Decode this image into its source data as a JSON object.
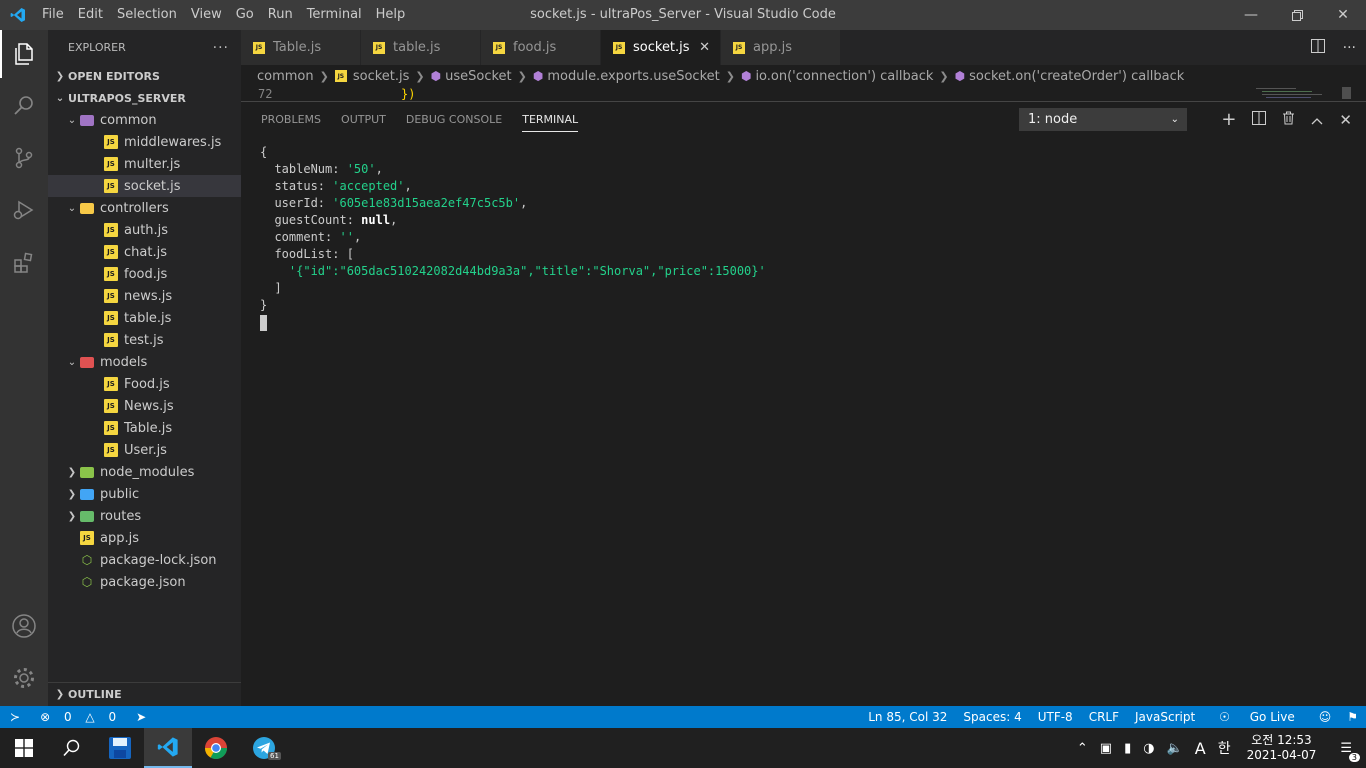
{
  "window": {
    "title": "socket.js - ultraPos_Server - Visual Studio Code",
    "menu": [
      "File",
      "Edit",
      "Selection",
      "View",
      "Go",
      "Run",
      "Terminal",
      "Help"
    ]
  },
  "sidebar": {
    "header": "EXPLORER",
    "open_editors": "OPEN EDITORS",
    "project": "ULTRAPOS_SERVER",
    "outline": "OUTLINE",
    "tree": [
      {
        "label": "common",
        "type": "folder",
        "depth": 1,
        "expanded": true
      },
      {
        "label": "middlewares.js",
        "type": "js",
        "depth": 2
      },
      {
        "label": "multer.js",
        "type": "js",
        "depth": 2
      },
      {
        "label": "socket.js",
        "type": "js",
        "depth": 2,
        "selected": true
      },
      {
        "label": "controllers",
        "type": "folder",
        "depth": 1,
        "expanded": true
      },
      {
        "label": "auth.js",
        "type": "js",
        "depth": 2
      },
      {
        "label": "chat.js",
        "type": "js",
        "depth": 2
      },
      {
        "label": "food.js",
        "type": "js",
        "depth": 2
      },
      {
        "label": "news.js",
        "type": "js",
        "depth": 2
      },
      {
        "label": "table.js",
        "type": "js",
        "depth": 2
      },
      {
        "label": "test.js",
        "type": "js",
        "depth": 2
      },
      {
        "label": "models",
        "type": "folder",
        "depth": 1,
        "expanded": true
      },
      {
        "label": "Food.js",
        "type": "js",
        "depth": 2
      },
      {
        "label": "News.js",
        "type": "js",
        "depth": 2
      },
      {
        "label": "Table.js",
        "type": "js",
        "depth": 2
      },
      {
        "label": "User.js",
        "type": "js",
        "depth": 2
      },
      {
        "label": "node_modules",
        "type": "folder",
        "depth": 1,
        "expanded": false
      },
      {
        "label": "public",
        "type": "folder",
        "depth": 1,
        "expanded": false
      },
      {
        "label": "routes",
        "type": "folder",
        "depth": 1,
        "expanded": false
      },
      {
        "label": "app.js",
        "type": "js",
        "depth": 1
      },
      {
        "label": "package-lock.json",
        "type": "json",
        "depth": 1
      },
      {
        "label": "package.json",
        "type": "json",
        "depth": 1
      }
    ]
  },
  "tabs": [
    {
      "label": "Table.js",
      "active": false
    },
    {
      "label": "table.js",
      "active": false
    },
    {
      "label": "food.js",
      "active": false
    },
    {
      "label": "socket.js",
      "active": true
    },
    {
      "label": "app.js",
      "active": false
    }
  ],
  "breadcrumb": [
    "common",
    "socket.js",
    "useSocket",
    "module.exports.useSocket",
    "io.on('connection') callback",
    "socket.on('createOrder') callback"
  ],
  "editor": {
    "line_number": "72",
    "line_code": "})"
  },
  "panel": {
    "tabs": [
      "PROBLEMS",
      "OUTPUT",
      "DEBUG CONSOLE",
      "TERMINAL"
    ],
    "active_tab": "TERMINAL",
    "terminal_select": "1: node",
    "terminal": {
      "open": "{",
      "tableNum_key": "  tableNum: ",
      "tableNum_val": "'50'",
      "status_key": "  status: ",
      "status_val": "'accepted'",
      "userId_key": "  userId: ",
      "userId_val": "'605e1e83d15aea2ef47c5c5b'",
      "guestCount_key": "  guestCount: ",
      "guestCount_val": "null",
      "comment_key": "  comment: ",
      "comment_val": "''",
      "foodList_key": "  foodList: [",
      "foodList_item": "'{\"id\":\"605dac510242082d44bd9a3a\",\"title\":\"Shorva\",\"price\":15000}'",
      "foodList_close": "  ]",
      "close": "}"
    }
  },
  "statusbar": {
    "errors": "0",
    "warnings": "0",
    "position": "Ln 85, Col 32",
    "spaces": "Spaces: 4",
    "encoding": "UTF-8",
    "eol": "CRLF",
    "language": "JavaScript",
    "golive": "Go Live"
  },
  "taskbar": {
    "time": "오전 12:53",
    "date": "2021-04-07",
    "ime": "한",
    "input_mode": "A",
    "notif_count": "3",
    "telegram_badge": "61"
  },
  "colors": {
    "accent": "#007acc",
    "folder_common": "#a074c4",
    "folder_controllers": "#f7c948",
    "folder_models": "#e05252",
    "folder_node_modules": "#8bc34a",
    "folder_public": "#42a5f5",
    "folder_routes": "#66bb6a"
  }
}
